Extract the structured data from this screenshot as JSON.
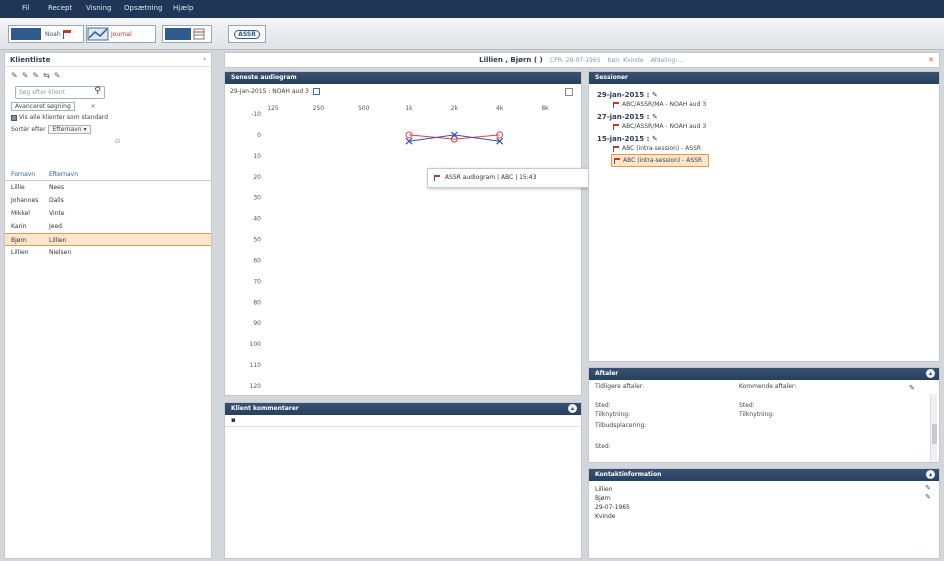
{
  "menubar": {
    "items": [
      "Fil",
      "Recept",
      "Visning",
      "Opsætning",
      "Hjælp"
    ]
  },
  "toolbar": {
    "buttons": [
      {
        "label": "Noah",
        "icon": "flag-icon"
      },
      {
        "label": "Journal",
        "icon": "chart-icon"
      },
      {
        "label": "",
        "icon": "grid-icon"
      }
    ],
    "assr_label": "ASSR"
  },
  "left_panel": {
    "title": "Klientliste",
    "close": "‹",
    "icons": [
      "add-client-icon",
      "edit-client-icon",
      "delete-client-icon",
      "link-client-icon",
      "refresh-icon"
    ],
    "search_placeholder": "Søg efter klient",
    "advanced_search": "Avanceret søgning",
    "show_active_label": "Vis alle klienter som standard",
    "sort_label": "Sortér efter",
    "sort_value": "Efternavn",
    "columns": [
      "Fornavn",
      "Efternavn"
    ],
    "rows": [
      {
        "first": "Lillie",
        "last": "Nees"
      },
      {
        "first": "Johannes",
        "last": "Dalls"
      },
      {
        "first": "Mikkel",
        "last": "Vinte"
      },
      {
        "first": "Karin",
        "last": "Jeed"
      },
      {
        "first": "Bjørn",
        "last": "Lillien"
      },
      {
        "first": "Lillien",
        "last": "Nielsen"
      }
    ],
    "selected_index": 4
  },
  "patient_bar": {
    "name": "Lillien , Bjørn ( )",
    "cpr": "CPR: 29-07-1965",
    "gender": "Køn: Kvinde",
    "extra": "Afdeling: ..."
  },
  "audiogram": {
    "title": "Seneste audiogram",
    "subtitle": "29-jan-2015 : NOAH aud 3",
    "x_labels": [
      "125",
      "250",
      "500",
      "1k",
      "2k",
      "4k",
      "8k"
    ],
    "y_labels": [
      "-10",
      "0",
      "10",
      "20",
      "30",
      "40",
      "50",
      "60",
      "70",
      "80",
      "90",
      "100",
      "110",
      "120"
    ],
    "tooltip": "ASSR audiogram  |  ABC  |  15:43"
  },
  "chart_data": {
    "type": "line",
    "categories": [
      "1k",
      "2k",
      "4k"
    ],
    "series": [
      {
        "values": [
          0,
          2,
          0
        ],
        "color": "#d9453e",
        "marker": "circle"
      },
      {
        "values": [
          3,
          0,
          3
        ],
        "color": "#3b4fb8",
        "marker": "x"
      }
    ],
    "ylim": [
      -10,
      120
    ],
    "reversed_y": true
  },
  "history": {
    "title": "Sessioner",
    "groups": [
      {
        "date": "29-jan-2015 :",
        "entries": [
          "ABC/ASSR/MA - NOAH aud 3"
        ]
      },
      {
        "date": "27-jan-2015 :",
        "entries": [
          "ABC/ASSR/MA - NOAH aud 3"
        ]
      },
      {
        "date": "15-jan-2015 :",
        "entries": [
          "ABC (intra-session) - ASSR",
          "ABC (intra-session) - ASSR"
        ]
      }
    ],
    "selected_entry": "ABC (intra-session) - ASSR"
  },
  "notes": {
    "title": "Klient kommentarer",
    "tool_icon": "save-icon"
  },
  "appointments": {
    "title": "Aftaler",
    "left_col": [
      "Tidligere aftaler:",
      "Sted:",
      "Tilknytning:",
      "Tilbudsplacering:",
      "Sted:"
    ],
    "right_col": [
      "Kommende aftaler:",
      "Sted:",
      "Tilknytning:"
    ]
  },
  "contact": {
    "title": "Kontaktinformation",
    "lines": [
      "Lillien",
      "Bjørn",
      "29-07-1965",
      "Kvinde"
    ]
  },
  "colors": {
    "header_dark": "#1f3656",
    "panel_header": "#26405f",
    "selection": "#fde5cc",
    "accent_orange": "#e59a4d"
  }
}
